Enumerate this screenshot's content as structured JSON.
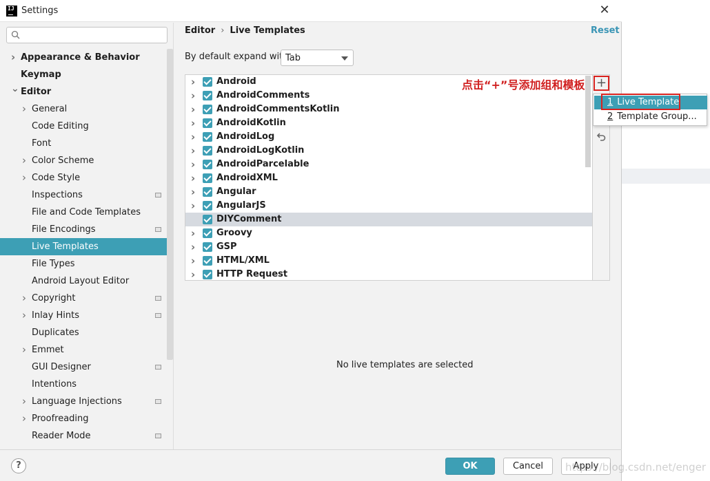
{
  "window": {
    "title": "Settings",
    "app_icon_text": "IJ"
  },
  "search": {
    "placeholder": ""
  },
  "sidebar": {
    "items": [
      {
        "label": "Appearance & Behavior",
        "arrow": "right",
        "bold": true
      },
      {
        "label": "Keymap",
        "bold": true
      },
      {
        "label": "Editor",
        "arrow": "down",
        "bold": true
      },
      {
        "label": "General",
        "arrow": "right"
      },
      {
        "label": "Code Editing"
      },
      {
        "label": "Font"
      },
      {
        "label": "Color Scheme",
        "arrow": "right"
      },
      {
        "label": "Code Style",
        "arrow": "right"
      },
      {
        "label": "Inspections",
        "badge": true
      },
      {
        "label": "File and Code Templates"
      },
      {
        "label": "File Encodings",
        "badge": true
      },
      {
        "label": "Live Templates",
        "selected": true
      },
      {
        "label": "File Types"
      },
      {
        "label": "Android Layout Editor"
      },
      {
        "label": "Copyright",
        "arrow": "right",
        "badge": true
      },
      {
        "label": "Inlay Hints",
        "arrow": "right",
        "badge": true
      },
      {
        "label": "Duplicates"
      },
      {
        "label": "Emmet",
        "arrow": "right"
      },
      {
        "label": "GUI Designer",
        "badge": true
      },
      {
        "label": "Intentions"
      },
      {
        "label": "Language Injections",
        "arrow": "right",
        "badge": true
      },
      {
        "label": "Proofreading",
        "arrow": "right"
      },
      {
        "label": "Reader Mode",
        "badge": true
      }
    ]
  },
  "breadcrumb": {
    "parent": "Editor",
    "separator": "›",
    "current": "Live Templates"
  },
  "reset_label": "Reset",
  "expand": {
    "label": "By default expand with",
    "value": "Tab"
  },
  "templates": [
    {
      "name": "Android",
      "expandable": true
    },
    {
      "name": "AndroidComments",
      "expandable": true
    },
    {
      "name": "AndroidCommentsKotlin",
      "expandable": true
    },
    {
      "name": "AndroidKotlin",
      "expandable": true
    },
    {
      "name": "AndroidLog",
      "expandable": true
    },
    {
      "name": "AndroidLogKotlin",
      "expandable": true
    },
    {
      "name": "AndroidParcelable",
      "expandable": true
    },
    {
      "name": "AndroidXML",
      "expandable": true
    },
    {
      "name": "Angular",
      "expandable": true
    },
    {
      "name": "AngularJS",
      "expandable": true
    },
    {
      "name": "DIYComment",
      "expandable": false,
      "selected": true
    },
    {
      "name": "Groovy",
      "expandable": true
    },
    {
      "name": "GSP",
      "expandable": true
    },
    {
      "name": "HTML/XML",
      "expandable": true
    },
    {
      "name": "HTTP Request",
      "expandable": true
    }
  ],
  "toolbar": {
    "add": "+",
    "undo": "↶"
  },
  "annotation": "点击“+”号添加组和模板",
  "popup": {
    "items": [
      {
        "mnemonic": "1",
        "label": "Live Template"
      },
      {
        "mnemonic": "2",
        "label": "Template Group..."
      }
    ]
  },
  "empty_message": "No live templates are selected",
  "footer": {
    "help": "?",
    "ok": "OK",
    "cancel": "Cancel",
    "apply": "Apply"
  },
  "watermark": "https://blog.csdn.net/engeria",
  "colors": {
    "accent": "#3d9fb5",
    "annotation": "#d9231f",
    "selected_row": "#d6dae0"
  }
}
